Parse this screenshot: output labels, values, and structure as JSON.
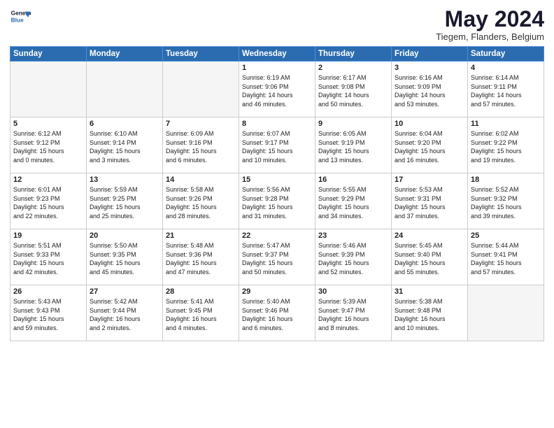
{
  "header": {
    "logo_line1": "General",
    "logo_line2": "Blue",
    "month_title": "May 2024",
    "subtitle": "Tiegem, Flanders, Belgium"
  },
  "weekdays": [
    "Sunday",
    "Monday",
    "Tuesday",
    "Wednesday",
    "Thursday",
    "Friday",
    "Saturday"
  ],
  "weeks": [
    [
      {
        "day": "",
        "info": ""
      },
      {
        "day": "",
        "info": ""
      },
      {
        "day": "",
        "info": ""
      },
      {
        "day": "1",
        "info": "Sunrise: 6:19 AM\nSunset: 9:06 PM\nDaylight: 14 hours\nand 46 minutes."
      },
      {
        "day": "2",
        "info": "Sunrise: 6:17 AM\nSunset: 9:08 PM\nDaylight: 14 hours\nand 50 minutes."
      },
      {
        "day": "3",
        "info": "Sunrise: 6:16 AM\nSunset: 9:09 PM\nDaylight: 14 hours\nand 53 minutes."
      },
      {
        "day": "4",
        "info": "Sunrise: 6:14 AM\nSunset: 9:11 PM\nDaylight: 14 hours\nand 57 minutes."
      }
    ],
    [
      {
        "day": "5",
        "info": "Sunrise: 6:12 AM\nSunset: 9:12 PM\nDaylight: 15 hours\nand 0 minutes."
      },
      {
        "day": "6",
        "info": "Sunrise: 6:10 AM\nSunset: 9:14 PM\nDaylight: 15 hours\nand 3 minutes."
      },
      {
        "day": "7",
        "info": "Sunrise: 6:09 AM\nSunset: 9:16 PM\nDaylight: 15 hours\nand 6 minutes."
      },
      {
        "day": "8",
        "info": "Sunrise: 6:07 AM\nSunset: 9:17 PM\nDaylight: 15 hours\nand 10 minutes."
      },
      {
        "day": "9",
        "info": "Sunrise: 6:05 AM\nSunset: 9:19 PM\nDaylight: 15 hours\nand 13 minutes."
      },
      {
        "day": "10",
        "info": "Sunrise: 6:04 AM\nSunset: 9:20 PM\nDaylight: 15 hours\nand 16 minutes."
      },
      {
        "day": "11",
        "info": "Sunrise: 6:02 AM\nSunset: 9:22 PM\nDaylight: 15 hours\nand 19 minutes."
      }
    ],
    [
      {
        "day": "12",
        "info": "Sunrise: 6:01 AM\nSunset: 9:23 PM\nDaylight: 15 hours\nand 22 minutes."
      },
      {
        "day": "13",
        "info": "Sunrise: 5:59 AM\nSunset: 9:25 PM\nDaylight: 15 hours\nand 25 minutes."
      },
      {
        "day": "14",
        "info": "Sunrise: 5:58 AM\nSunset: 9:26 PM\nDaylight: 15 hours\nand 28 minutes."
      },
      {
        "day": "15",
        "info": "Sunrise: 5:56 AM\nSunset: 9:28 PM\nDaylight: 15 hours\nand 31 minutes."
      },
      {
        "day": "16",
        "info": "Sunrise: 5:55 AM\nSunset: 9:29 PM\nDaylight: 15 hours\nand 34 minutes."
      },
      {
        "day": "17",
        "info": "Sunrise: 5:53 AM\nSunset: 9:31 PM\nDaylight: 15 hours\nand 37 minutes."
      },
      {
        "day": "18",
        "info": "Sunrise: 5:52 AM\nSunset: 9:32 PM\nDaylight: 15 hours\nand 39 minutes."
      }
    ],
    [
      {
        "day": "19",
        "info": "Sunrise: 5:51 AM\nSunset: 9:33 PM\nDaylight: 15 hours\nand 42 minutes."
      },
      {
        "day": "20",
        "info": "Sunrise: 5:50 AM\nSunset: 9:35 PM\nDaylight: 15 hours\nand 45 minutes."
      },
      {
        "day": "21",
        "info": "Sunrise: 5:48 AM\nSunset: 9:36 PM\nDaylight: 15 hours\nand 47 minutes."
      },
      {
        "day": "22",
        "info": "Sunrise: 5:47 AM\nSunset: 9:37 PM\nDaylight: 15 hours\nand 50 minutes."
      },
      {
        "day": "23",
        "info": "Sunrise: 5:46 AM\nSunset: 9:39 PM\nDaylight: 15 hours\nand 52 minutes."
      },
      {
        "day": "24",
        "info": "Sunrise: 5:45 AM\nSunset: 9:40 PM\nDaylight: 15 hours\nand 55 minutes."
      },
      {
        "day": "25",
        "info": "Sunrise: 5:44 AM\nSunset: 9:41 PM\nDaylight: 15 hours\nand 57 minutes."
      }
    ],
    [
      {
        "day": "26",
        "info": "Sunrise: 5:43 AM\nSunset: 9:43 PM\nDaylight: 15 hours\nand 59 minutes."
      },
      {
        "day": "27",
        "info": "Sunrise: 5:42 AM\nSunset: 9:44 PM\nDaylight: 16 hours\nand 2 minutes."
      },
      {
        "day": "28",
        "info": "Sunrise: 5:41 AM\nSunset: 9:45 PM\nDaylight: 16 hours\nand 4 minutes."
      },
      {
        "day": "29",
        "info": "Sunrise: 5:40 AM\nSunset: 9:46 PM\nDaylight: 16 hours\nand 6 minutes."
      },
      {
        "day": "30",
        "info": "Sunrise: 5:39 AM\nSunset: 9:47 PM\nDaylight: 16 hours\nand 8 minutes."
      },
      {
        "day": "31",
        "info": "Sunrise: 5:38 AM\nSunset: 9:48 PM\nDaylight: 16 hours\nand 10 minutes."
      },
      {
        "day": "",
        "info": ""
      }
    ]
  ]
}
